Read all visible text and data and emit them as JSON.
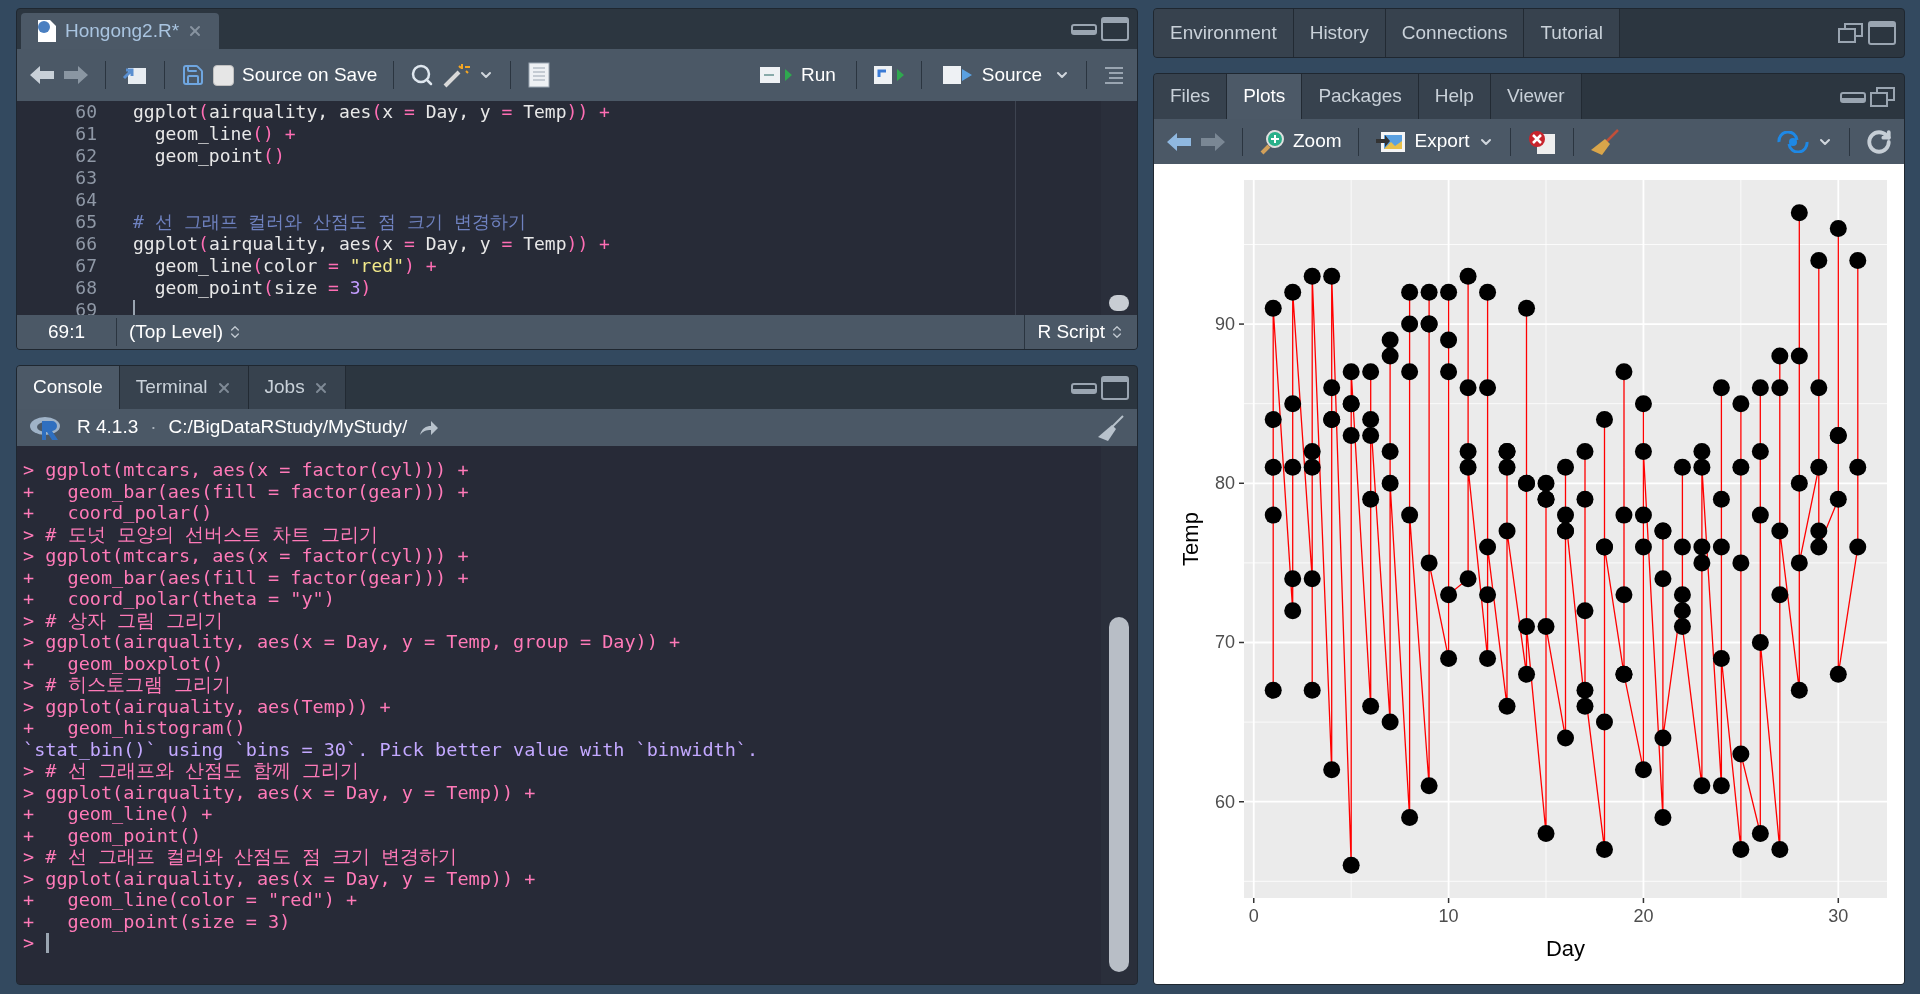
{
  "editor": {
    "tab": {
      "title": "Hongong2.R*",
      "selected": true
    },
    "toolbar": {
      "source_on_save": {
        "label": "Source on Save",
        "checked": false
      },
      "run": "Run",
      "source": "Source"
    },
    "lines": [
      {
        "number": "60",
        "tokens": [
          {
            "kind": "plain",
            "text": "ggplot"
          },
          {
            "kind": "op",
            "text": "("
          },
          {
            "kind": "plain",
            "text": "airquality, aes"
          },
          {
            "kind": "op",
            "text": "("
          },
          {
            "kind": "plain",
            "text": "x "
          },
          {
            "kind": "op",
            "text": "="
          },
          {
            "kind": "plain",
            "text": " Day, y "
          },
          {
            "kind": "op",
            "text": "="
          },
          {
            "kind": "plain",
            "text": " Temp"
          },
          {
            "kind": "op",
            "text": ")) +"
          }
        ]
      },
      {
        "number": "61",
        "tokens": [
          {
            "kind": "plain",
            "text": "  geom_line"
          },
          {
            "kind": "op",
            "text": "() +"
          }
        ]
      },
      {
        "number": "62",
        "tokens": [
          {
            "kind": "plain",
            "text": "  geom_point"
          },
          {
            "kind": "op",
            "text": "()"
          }
        ]
      },
      {
        "number": "63"
      },
      {
        "number": "64"
      },
      {
        "number": "65",
        "tokens": [
          {
            "kind": "comment",
            "text": "# 선 그래프 컬러와 산점도 점 크기 변경하기"
          }
        ]
      },
      {
        "number": "66",
        "tokens": [
          {
            "kind": "plain",
            "text": "ggplot"
          },
          {
            "kind": "op",
            "text": "("
          },
          {
            "kind": "plain",
            "text": "airquality, aes"
          },
          {
            "kind": "op",
            "text": "("
          },
          {
            "kind": "plain",
            "text": "x "
          },
          {
            "kind": "op",
            "text": "="
          },
          {
            "kind": "plain",
            "text": " Day, y "
          },
          {
            "kind": "op",
            "text": "="
          },
          {
            "kind": "plain",
            "text": " Temp"
          },
          {
            "kind": "op",
            "text": ")) +"
          }
        ]
      },
      {
        "number": "67",
        "tokens": [
          {
            "kind": "plain",
            "text": "  geom_line"
          },
          {
            "kind": "op",
            "text": "("
          },
          {
            "kind": "plain",
            "text": "color "
          },
          {
            "kind": "op",
            "text": "= "
          },
          {
            "kind": "string",
            "text": "\"red\""
          },
          {
            "kind": "op",
            "text": ") +"
          }
        ]
      },
      {
        "number": "68",
        "tokens": [
          {
            "kind": "plain",
            "text": "  geom_point"
          },
          {
            "kind": "op",
            "text": "("
          },
          {
            "kind": "plain",
            "text": "size "
          },
          {
            "kind": "op",
            "text": "= "
          },
          {
            "kind": "number",
            "text": "3"
          },
          {
            "kind": "op",
            "text": ")"
          }
        ]
      },
      {
        "number": "69",
        "cursor": true
      }
    ],
    "status": {
      "position": "69:1",
      "scope": "(Top Level)",
      "file_type": "R Script"
    }
  },
  "console": {
    "tabs": [
      {
        "label": "Console",
        "selected": true,
        "closable": false
      },
      {
        "label": "Terminal",
        "selected": false,
        "closable": true
      },
      {
        "label": "Jobs",
        "selected": false,
        "closable": true
      }
    ],
    "version": "R 4.1.3",
    "separator": "·",
    "path": "C:/BigDataRStudy/MyStudy/",
    "lines": [
      {
        "kind": "input",
        "text": "> ggplot(mtcars, aes(x = factor(cyl))) +"
      },
      {
        "kind": "input",
        "text": "+   geom_bar(aes(fill = factor(gear))) +"
      },
      {
        "kind": "input",
        "text": "+   coord_polar()"
      },
      {
        "kind": "input",
        "text": "> # 도넛 모양의 선버스트 차트 그리기"
      },
      {
        "kind": "input",
        "text": "> ggplot(mtcars, aes(x = factor(cyl))) +"
      },
      {
        "kind": "input",
        "text": "+   geom_bar(aes(fill = factor(gear))) +"
      },
      {
        "kind": "input",
        "text": "+   coord_polar(theta = \"y\")"
      },
      {
        "kind": "input",
        "text": "> # 상자 그림 그리기"
      },
      {
        "kind": "input",
        "text": "> ggplot(airquality, aes(x = Day, y = Temp, group = Day)) +"
      },
      {
        "kind": "input",
        "text": "+   geom_boxplot()"
      },
      {
        "kind": "input",
        "text": "> # 히스토그램 그리기"
      },
      {
        "kind": "input",
        "text": "> ggplot(airquality, aes(Temp)) +"
      },
      {
        "kind": "input",
        "text": "+   geom_histogram()"
      },
      {
        "kind": "message",
        "text": "`stat_bin()` using `bins = 30`. Pick better value with `binwidth`."
      },
      {
        "kind": "input",
        "text": "> # 선 그래프와 산점도 함께 그리기"
      },
      {
        "kind": "input",
        "text": "> ggplot(airquality, aes(x = Day, y = Temp)) +"
      },
      {
        "kind": "input",
        "text": "+   geom_line() +"
      },
      {
        "kind": "input",
        "text": "+   geom_point()"
      },
      {
        "kind": "input",
        "text": "> # 선 그래프 컬러와 산점도 점 크기 변경하기"
      },
      {
        "kind": "input",
        "text": "> ggplot(airquality, aes(x = Day, y = Temp)) +"
      },
      {
        "kind": "input",
        "text": "+   geom_line(color = \"red\") +"
      },
      {
        "kind": "input",
        "text": "+   geom_point(size = 3)"
      },
      {
        "kind": "prompt",
        "text": ">"
      }
    ]
  },
  "environment_pane": {
    "tabs": [
      {
        "label": "Environment",
        "selected": false
      },
      {
        "label": "History",
        "selected": false
      },
      {
        "label": "Connections",
        "selected": false
      },
      {
        "label": "Tutorial",
        "selected": false
      }
    ]
  },
  "files_pane": {
    "tabs": [
      {
        "label": "Files",
        "selected": false
      },
      {
        "label": "Plots",
        "selected": true
      },
      {
        "label": "Packages",
        "selected": false
      },
      {
        "label": "Help",
        "selected": false
      },
      {
        "label": "Viewer",
        "selected": false
      }
    ],
    "toolbar": {
      "zoom": "Zoom",
      "export": "Export"
    },
    "chart_data": {
      "type": "line",
      "xlabel": "Day",
      "ylabel": "Temp",
      "grid": true,
      "xlim": [
        -0.5,
        32.5
      ],
      "ylim": [
        53.95,
        99.05
      ],
      "xticks": [
        0,
        10,
        20,
        30
      ],
      "yticks": [
        60,
        70,
        80,
        90
      ],
      "x": [
        1,
        1,
        1,
        1,
        1,
        2,
        2,
        2,
        2,
        2,
        3,
        3,
        3,
        3,
        3,
        4,
        4,
        4,
        4,
        4,
        5,
        5,
        5,
        5,
        5,
        6,
        6,
        6,
        6,
        6,
        7,
        7,
        7,
        7,
        7,
        8,
        8,
        8,
        8,
        8,
        9,
        9,
        9,
        9,
        9,
        10,
        10,
        10,
        10,
        10,
        11,
        11,
        11,
        11,
        11,
        12,
        12,
        12,
        12,
        12,
        13,
        13,
        13,
        13,
        13,
        14,
        14,
        14,
        14,
        14,
        15,
        15,
        15,
        15,
        15,
        16,
        16,
        16,
        16,
        16,
        17,
        17,
        17,
        17,
        17,
        18,
        18,
        18,
        18,
        18,
        19,
        19,
        19,
        19,
        19,
        20,
        20,
        20,
        20,
        20,
        21,
        21,
        21,
        21,
        21,
        22,
        22,
        22,
        22,
        22,
        23,
        23,
        23,
        23,
        23,
        24,
        24,
        24,
        24,
        24,
        25,
        25,
        25,
        25,
        25,
        26,
        26,
        26,
        26,
        26,
        27,
        27,
        27,
        27,
        27,
        28,
        28,
        28,
        28,
        28,
        29,
        29,
        29,
        29,
        29,
        30,
        30,
        30,
        30,
        30,
        31,
        31,
        31
      ],
      "series": [
        {
          "color": "#ff0000",
          "marker": "circle",
          "values": [
            67,
            78,
            84,
            81,
            91,
            72,
            74,
            85,
            81,
            92,
            74,
            67,
            81,
            82,
            93,
            62,
            84,
            84,
            86,
            93,
            56,
            85,
            83,
            85,
            87,
            66,
            79,
            83,
            87,
            84,
            65,
            82,
            88,
            89,
            80,
            59,
            87,
            92,
            90,
            78,
            61,
            90,
            92,
            90,
            75,
            69,
            87,
            89,
            92,
            73,
            74,
            93,
            82,
            86,
            81,
            69,
            92,
            73,
            86,
            76,
            66,
            82,
            81,
            82,
            77,
            68,
            80,
            91,
            80,
            71,
            58,
            79,
            80,
            79,
            71,
            64,
            77,
            81,
            77,
            78,
            66,
            72,
            82,
            79,
            67,
            57,
            65,
            84,
            76,
            76,
            68,
            73,
            87,
            78,
            68,
            62,
            76,
            85,
            78,
            82,
            59,
            77,
            74,
            77,
            64,
            73,
            76,
            81,
            72,
            71,
            61,
            76,
            82,
            75,
            81,
            61,
            76,
            86,
            79,
            69,
            57,
            75,
            85,
            81,
            63,
            58,
            78,
            82,
            86,
            70,
            57,
            73,
            86,
            88,
            77,
            67,
            80,
            88,
            97,
            75,
            81,
            77,
            86,
            94,
            76,
            79,
            83,
            83,
            96,
            68,
            76,
            81,
            94
          ]
        }
      ]
    }
  }
}
